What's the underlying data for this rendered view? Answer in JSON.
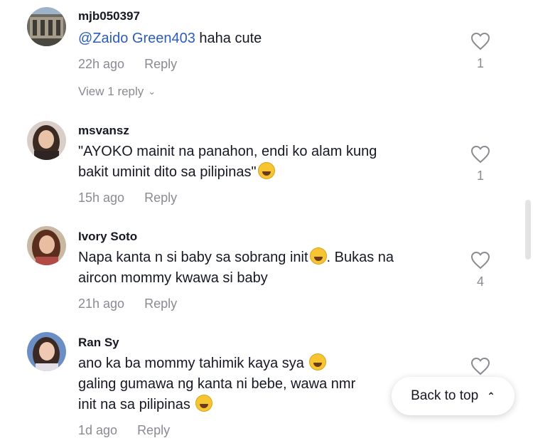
{
  "comments": [
    {
      "username": "mjb050397",
      "mention": "@Zaido Green403",
      "text": " haha cute",
      "time": "22h ago",
      "reply_label": "Reply",
      "likes": "1",
      "view_replies": "View 1 reply"
    },
    {
      "username": "msvansz",
      "line1": "\"AYOKO mainit na panahon, endi ko alam kung",
      "line2": "bakit uminit dito sa pilipinas\"",
      "time": "15h ago",
      "reply_label": "Reply",
      "likes": "1"
    },
    {
      "username": "Ivory Soto",
      "line1a": "Napa kanta n si baby sa sobrang init",
      "line1b": ". Bukas na",
      "line2": "aircon mommy kwawa si baby",
      "time": "21h ago",
      "reply_label": "Reply",
      "likes": "4"
    },
    {
      "username": "Ran Sy",
      "line1": "ano ka ba mommy tahimik kaya sya ",
      "line2": "galing gumawa ng kanta ni bebe, wawa nmr",
      "line3": "init na sa pilipinas ",
      "time": "1d ago",
      "reply_label": "Reply"
    }
  ],
  "back_to_top": {
    "label": "Back to top",
    "icon": "double-chevron-up-icon"
  },
  "colors": {
    "mention": "#2b5db9",
    "muted": "#8a8b91",
    "text": "#161823"
  }
}
